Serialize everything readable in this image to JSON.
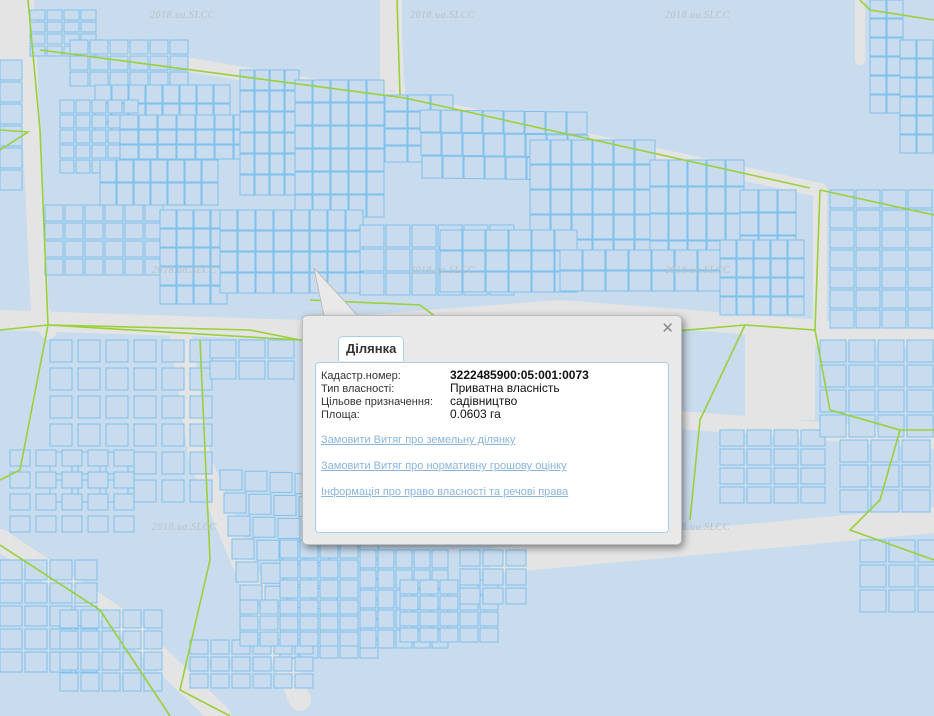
{
  "map": {
    "watermark": "2018.ua.SLCC",
    "colors": {
      "background": "#c9dced",
      "parcel_fill": "#c8dcee",
      "parcel_stroke": "#7fc0ec",
      "road": "#e4e4e4",
      "boundary": "#9ad03a"
    }
  },
  "popup": {
    "tab_label": "Ділянка",
    "close_icon": "close-icon",
    "fields": [
      {
        "key": "Кадастр.номер:",
        "value": "3222485900:05:001:0073"
      },
      {
        "key": "Тип власності:",
        "value": "Приватна власність"
      },
      {
        "key": "Цільове призначення:",
        "value": "садівництво"
      },
      {
        "key": "Площа:",
        "value": "0.0603 га"
      }
    ],
    "links": [
      "Замовити Витяг про земельну ділянку",
      "Замовити Витяг про нормативну грошову оцінку",
      "Інформація про право власності та речові права"
    ]
  }
}
